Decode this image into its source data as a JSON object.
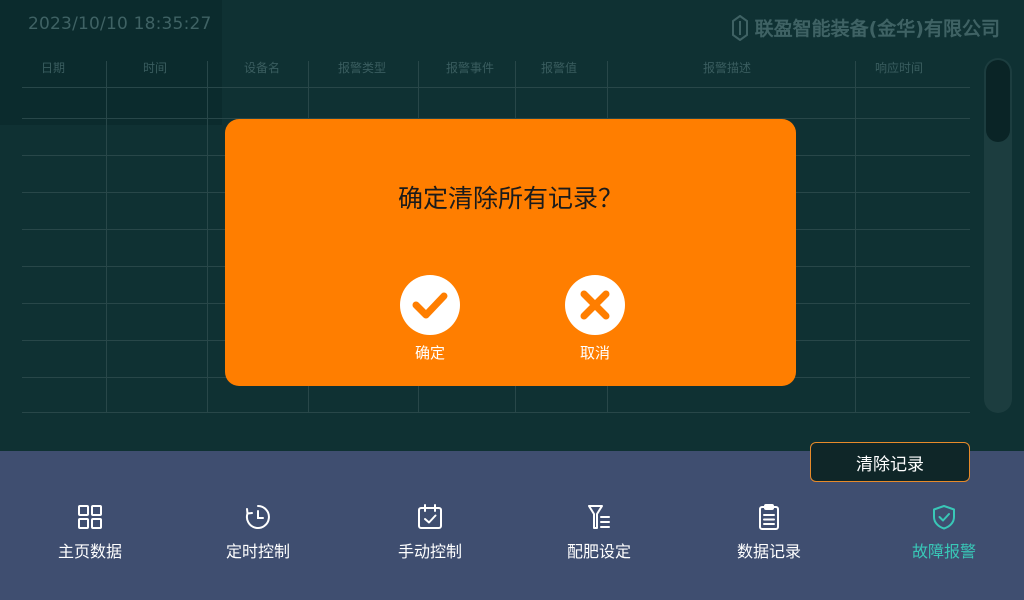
{
  "header": {
    "datetime": "2023/10/10  18:35:27",
    "brand": "联盈智能装备(金华)有限公司"
  },
  "table": {
    "columns": [
      "日期",
      "时间",
      "设备名",
      "报警类型",
      "报警事件",
      "报警值",
      "报警描述",
      "响应时间"
    ]
  },
  "actions": {
    "clear_label": "清除记录"
  },
  "nav": {
    "items": [
      {
        "label": "主页数据",
        "icon": "grid-icon"
      },
      {
        "label": "定时控制",
        "icon": "timer-icon"
      },
      {
        "label": "手动控制",
        "icon": "calendar-check-icon"
      },
      {
        "label": "配肥设定",
        "icon": "fertilizer-icon"
      },
      {
        "label": "数据记录",
        "icon": "clipboard-icon"
      },
      {
        "label": "故障报警",
        "icon": "shield-check-icon",
        "active": true
      }
    ]
  },
  "dialog": {
    "message": "确定清除所有记录？",
    "confirm_label": "确定",
    "cancel_label": "取消"
  },
  "colors": {
    "modal": "#ff7e00",
    "nav_bar": "#3f4e70",
    "active": "#39c7b7",
    "button_border": "#e78a2a"
  }
}
